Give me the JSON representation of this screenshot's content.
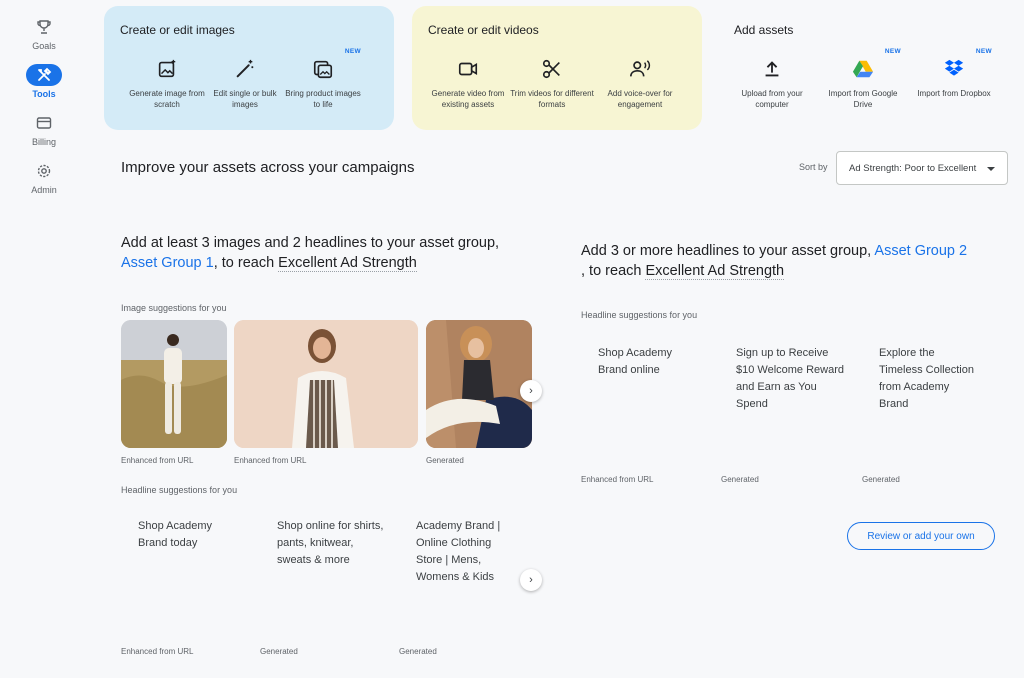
{
  "nav": {
    "goals": "Goals",
    "tools": "Tools",
    "billing": "Billing",
    "admin": "Admin"
  },
  "cards": {
    "images": {
      "title": "Create or edit images",
      "tools": [
        {
          "label": "Generate image from scratch"
        },
        {
          "label": "Edit single or bulk images"
        },
        {
          "label": "Bring product images to life",
          "badge": "NEW"
        }
      ]
    },
    "videos": {
      "title": "Create or edit videos",
      "tools": [
        {
          "label": "Generate video from existing assets"
        },
        {
          "label": "Trim videos for different formats"
        },
        {
          "label": "Add voice-over for engagement"
        }
      ]
    },
    "assets": {
      "title": "Add assets",
      "tools": [
        {
          "label": "Upload from your computer"
        },
        {
          "label": "Import from Google Drive",
          "badge": "NEW"
        },
        {
          "label": "Import from Dropbox",
          "badge": "NEW"
        }
      ]
    }
  },
  "section": {
    "title": "Improve your assets across your campaigns",
    "sort_label": "Sort by",
    "sort_value": "Ad Strength: Poor to Excellent"
  },
  "rec1": {
    "prefix": "Add at least 3 images and 2 headlines to your asset group,",
    "group": "Asset Group 1",
    "mid": ", to reach ",
    "goal": "Excellent Ad Strength",
    "image_label": "Image suggestions for you",
    "image_captions": [
      "Enhanced from URL",
      "Enhanced from URL",
      "Generated"
    ],
    "headline_label": "Headline suggestions for you",
    "headlines": [
      {
        "text": "Shop Academy Brand today",
        "caption": "Enhanced from URL"
      },
      {
        "text": "Shop online for shirts, pants, knitwear, sweats & more",
        "caption": "Generated"
      },
      {
        "text": "Academy Brand | Online Clothing Store | Mens, Womens & Kids",
        "caption": "Generated"
      }
    ]
  },
  "rec2": {
    "prefix": "Add 3 or more headlines to your asset group,",
    "group": "Asset Group 2",
    "mid": ", to reach ",
    "goal": "Excellent Ad Strength",
    "headline_label": "Headline suggestions for you",
    "headlines": [
      {
        "text": "Shop Academy Brand online",
        "caption": "Enhanced from URL"
      },
      {
        "text": "Sign up to Receive $10 Welcome Reward and Earn as You Spend",
        "caption": "Generated"
      },
      {
        "text": "Explore the Timeless Collection from Academy Brand",
        "caption": "Generated"
      }
    ],
    "review_label": "Review or add your own"
  },
  "colors": {
    "accent": "#1a73e8",
    "images_card": "#d4ebf7",
    "videos_card": "#f7f5d3"
  },
  "icons": {
    "goals": "trophy-icon",
    "tools": "wrench-screwdriver-icon",
    "billing": "credit-card-icon",
    "admin": "gear-icon"
  }
}
